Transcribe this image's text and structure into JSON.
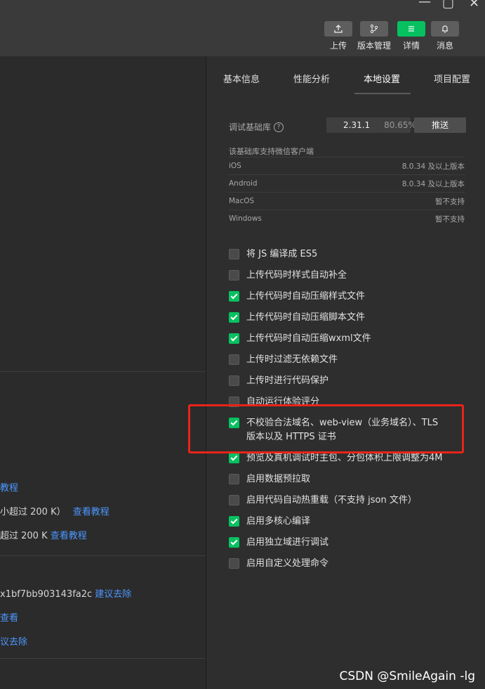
{
  "toolbar": {
    "upload": {
      "label": "上传",
      "icon": "upload-icon"
    },
    "version": {
      "label": "版本管理",
      "icon": "branch-icon"
    },
    "details": {
      "label": "详情",
      "icon": "menu-icon"
    },
    "messages": {
      "label": "消息",
      "icon": "bell-icon"
    }
  },
  "left": {
    "line1_link": "教程",
    "line2_text": "小超过 200 K）",
    "line2_link": "查看教程",
    "line3_text": "超过 200 K",
    "line3_link": "查看教程",
    "line4_text": "x1bf7bb903143fa2c",
    "line4_link": "建议去除",
    "line5_link": "查看",
    "line6_link": "议去除"
  },
  "tabs": [
    "基本信息",
    "性能分析",
    "本地设置",
    "项目配置"
  ],
  "active_tab": "本地设置",
  "sdk": {
    "label": "调试基础库",
    "version": "2.31.1",
    "percent": "80.65%",
    "push": "推送",
    "support_title": "该基础库支持微信客户端",
    "rows": [
      {
        "platform": "iOS",
        "req": "8.0.34 及以上版本"
      },
      {
        "platform": "Android",
        "req": "8.0.34 及以上版本"
      },
      {
        "platform": "MacOS",
        "req": "暂不支持"
      },
      {
        "platform": "Windows",
        "req": "暂不支持"
      }
    ]
  },
  "options": [
    {
      "label": "将 JS 编译成 ES5",
      "checked": false
    },
    {
      "label": "上传代码时样式自动补全",
      "checked": false
    },
    {
      "label": "上传代码时自动压缩样式文件",
      "checked": true
    },
    {
      "label": "上传代码时自动压缩脚本文件",
      "checked": true
    },
    {
      "label": "上传代码时自动压缩wxml文件",
      "checked": true
    },
    {
      "label": "上传时过滤无依赖文件",
      "checked": false
    },
    {
      "label": "上传时进行代码保护",
      "checked": false
    },
    {
      "label": "自动运行体验评分",
      "checked": false
    },
    {
      "label": "不校验合法域名、web-view（业务域名）、TLS 版本以及 HTTPS 证书",
      "checked": true
    },
    {
      "label": "预览及真机调试时主包、分包体积上限调整为4M",
      "checked": true
    },
    {
      "label": "启用数据预拉取",
      "checked": false
    },
    {
      "label": "启用代码自动热重载（不支持 json 文件）",
      "checked": false
    },
    {
      "label": "启用多核心编译",
      "checked": true
    },
    {
      "label": "启用独立域进行调试",
      "checked": true
    },
    {
      "label": "启用自定义处理命令",
      "checked": false
    }
  ],
  "watermark": "CSDN @SmileAgain -lg",
  "colors": {
    "accent": "#07c160",
    "highlight": "#e8241a",
    "link": "#4d97ff"
  }
}
